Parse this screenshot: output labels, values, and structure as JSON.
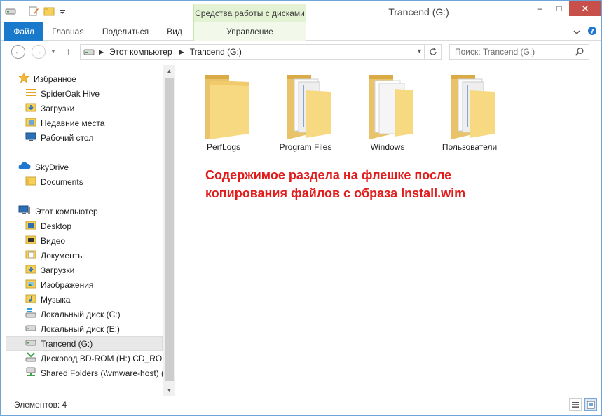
{
  "window": {
    "title": "Trancend (G:)",
    "contextual_group": "Средства работы с дисками",
    "controls": {
      "minimize": "–",
      "maximize": "□",
      "close": "✕"
    }
  },
  "ribbon": {
    "tabs": [
      "Файл",
      "Главная",
      "Поделиться",
      "Вид",
      "Управление"
    ]
  },
  "address": {
    "crumbs": [
      "Этот компьютер",
      "Trancend (G:)"
    ]
  },
  "search": {
    "placeholder": "Поиск: Trancend (G:)"
  },
  "nav": {
    "favorites": "Избранное",
    "fav_items": [
      "SpiderOak Hive",
      "Загрузки",
      "Недавние места",
      "Рабочий стол"
    ],
    "skydrive": "SkyDrive",
    "skydrive_items": [
      "Documents"
    ],
    "computer": "Этот компьютер",
    "computer_items": [
      "Desktop",
      "Видео",
      "Документы",
      "Загрузки",
      "Изображения",
      "Музыка",
      "Локальный диск (C:)",
      "Локальный диск (E:)",
      "Trancend (G:)",
      "Дисковод BD-ROM (H:) CD_ROM",
      "Shared Folders (\\\\vmware-host) ("
    ]
  },
  "folders": [
    "PerfLogs",
    "Program Files",
    "Windows",
    "Пользователи"
  ],
  "annotation": {
    "line1": "Содержимое раздела на флешке после",
    "line2": "копирования файлов с образа Install.wim"
  },
  "status": {
    "items": "Элементов: 4"
  },
  "colors": {
    "accent": "#1979ca",
    "contextual": "#e4f2d4",
    "close": "#c7504a",
    "annotation": "#e21b1b"
  }
}
